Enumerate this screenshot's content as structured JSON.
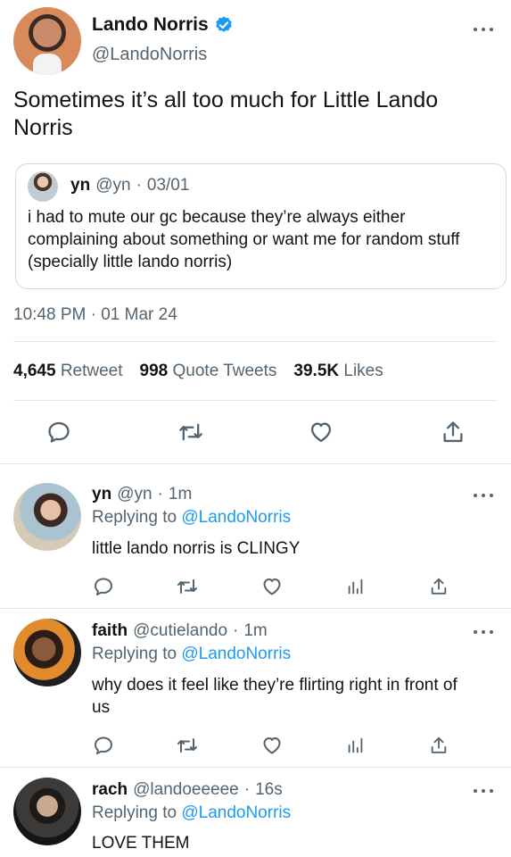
{
  "tweet": {
    "author_name": "Lando Norris",
    "author_handle": "@LandoNorris",
    "text": "Sometimes it’s all too much for Little Lando Norris",
    "quote": {
      "name": "yn",
      "handle": "@yn",
      "date": "03/01",
      "text": "i had to mute our gc because they’re always either complaining about something or want me for random stuff (specially little lando norris)"
    },
    "timestamp": "10:48 PM · 01 Mar 24",
    "stats": {
      "retweets_count": "4,645",
      "retweets_label": "Retweet",
      "quotes_count": "998",
      "quotes_label": "Quote Tweets",
      "likes_count": "39.5K",
      "likes_label": "Likes"
    }
  },
  "replies": [
    {
      "name": "yn",
      "handle": "@yn",
      "time": "1m",
      "replying_prefix": "Replying to",
      "replying_to": "@LandoNorris",
      "text": "little lando norris is CLINGY"
    },
    {
      "name": "faith",
      "handle": "@cutielando",
      "time": "1m",
      "replying_prefix": "Replying to",
      "replying_to": "@LandoNorris",
      "text": "why does it feel like they’re flirting right in front of us"
    },
    {
      "name": "rach",
      "handle": "@landoeeeee",
      "time": "16s",
      "replying_prefix": "Replying to",
      "replying_to": "@LandoNorris",
      "text": "LOVE THEM"
    }
  ],
  "colors": {
    "accent": "#1d9bf0",
    "text": "#0f1419",
    "muted": "#536471",
    "divider": "#e6e9eb"
  },
  "icons": [
    "verified-badge-icon",
    "more-icon",
    "reply-icon",
    "retweet-icon",
    "like-icon",
    "share-icon",
    "analytics-icon"
  ]
}
